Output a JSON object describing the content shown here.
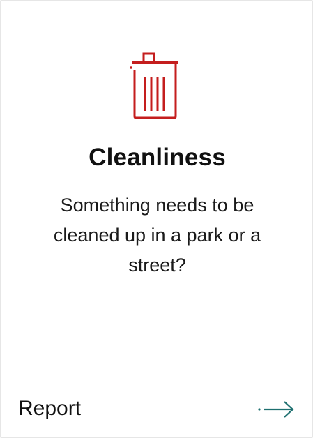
{
  "card": {
    "title": "Cleanliness",
    "description": "Something needs to be cleaned up in a park or a street?",
    "action_label": "Report",
    "icon": "trash-can-icon",
    "action_icon": "arrow-right-icon"
  },
  "colors": {
    "icon_red": "#c41e1e",
    "arrow_teal": "#1d6f6f",
    "text": "#111111"
  }
}
